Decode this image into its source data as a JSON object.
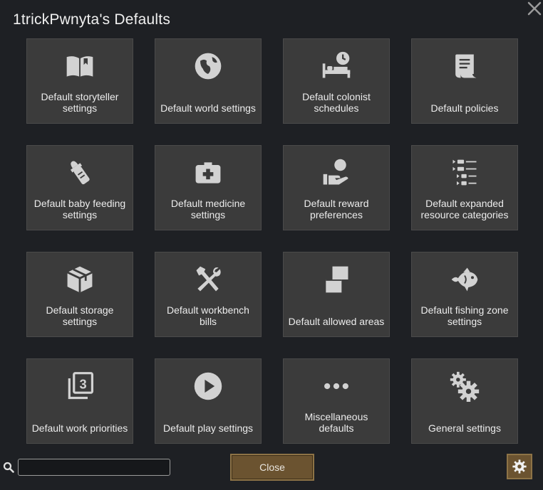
{
  "window": {
    "title": "1trickPwnyta's Defaults",
    "close_icon": "close-x-icon"
  },
  "tiles": [
    {
      "label": "Default storyteller settings",
      "icon": "book-icon"
    },
    {
      "label": "Default world settings",
      "icon": "globe-icon"
    },
    {
      "label": "Default colonist schedules",
      "icon": "bed-clock-icon"
    },
    {
      "label": "Default policies",
      "icon": "scroll-icon"
    },
    {
      "label": "Default baby feeding settings",
      "icon": "baby-bottle-icon"
    },
    {
      "label": "Default medicine settings",
      "icon": "medkit-icon"
    },
    {
      "label": "Default reward preferences",
      "icon": "hand-person-icon"
    },
    {
      "label": "Default expanded resource categories",
      "icon": "tree-list-icon"
    },
    {
      "label": "Default storage settings",
      "icon": "box-icon"
    },
    {
      "label": "Default workbench bills",
      "icon": "hammer-wrench-icon"
    },
    {
      "label": "Default allowed areas",
      "icon": "areas-icon"
    },
    {
      "label": "Default fishing zone settings",
      "icon": "fish-icon"
    },
    {
      "label": "Default work priorities",
      "icon": "priority-3-icon"
    },
    {
      "label": "Default play settings",
      "icon": "play-icon"
    },
    {
      "label": "Miscellaneous defaults",
      "icon": "ellipsis-icon"
    },
    {
      "label": "General settings",
      "icon": "gears-icon"
    }
  ],
  "footer": {
    "search_icon": "search-icon",
    "search_value": "",
    "close_label": "Close",
    "settings_icon": "gear-icon"
  },
  "colors": {
    "background": "#1e2024",
    "tile": "#3b3b3b",
    "button": "#6b5330",
    "icon": "#d2d2d2"
  }
}
